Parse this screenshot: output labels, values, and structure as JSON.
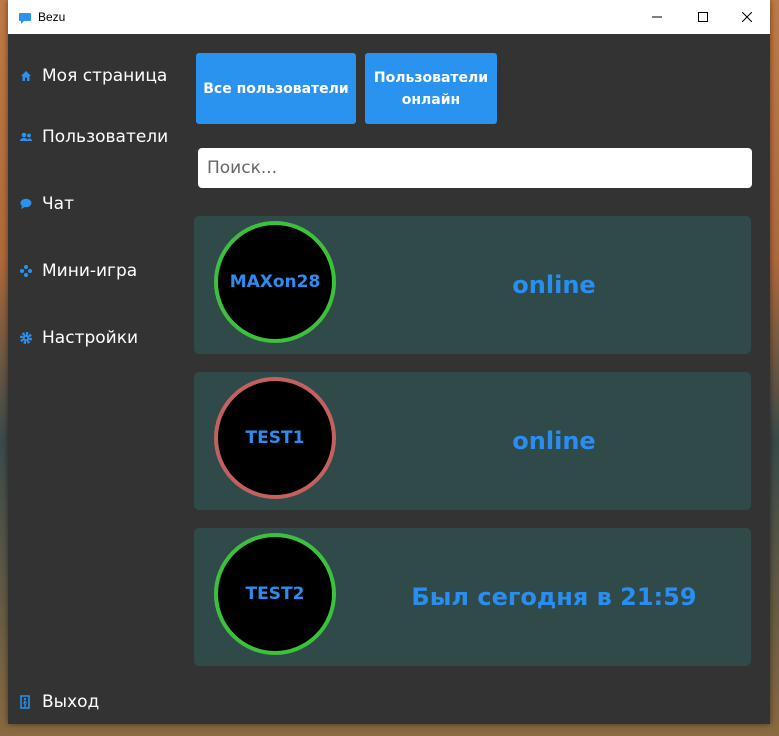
{
  "window": {
    "title": "Bezu"
  },
  "sidebar": {
    "items": [
      {
        "label": "Моя страница",
        "icon": "home-icon"
      },
      {
        "label": "Пользователи",
        "icon": "users-icon"
      },
      {
        "label": "Чат",
        "icon": "chat-icon"
      },
      {
        "label": "Мини-игра",
        "icon": "gamepad-icon"
      },
      {
        "label": "Настройки",
        "icon": "gear-icon"
      }
    ],
    "exit": {
      "label": "Выход",
      "icon": "exit-icon"
    }
  },
  "filters": {
    "all_label": "Все пользователи",
    "online_line1": "Пользователи",
    "online_line2": "онлайн"
  },
  "search": {
    "placeholder": "Поиск..."
  },
  "users": [
    {
      "name": "MAXon28",
      "status": "online",
      "ring_color": "#3cc13c"
    },
    {
      "name": "TEST1",
      "status": "online",
      "ring_color": "#c46060"
    },
    {
      "name": "TEST2",
      "status": "Был сегодня в 21:59",
      "ring_color": "#3cc13c"
    }
  ],
  "colors": {
    "accent": "#2a93f0",
    "card_bg": "#2f4a49",
    "window_bg": "#333333"
  }
}
